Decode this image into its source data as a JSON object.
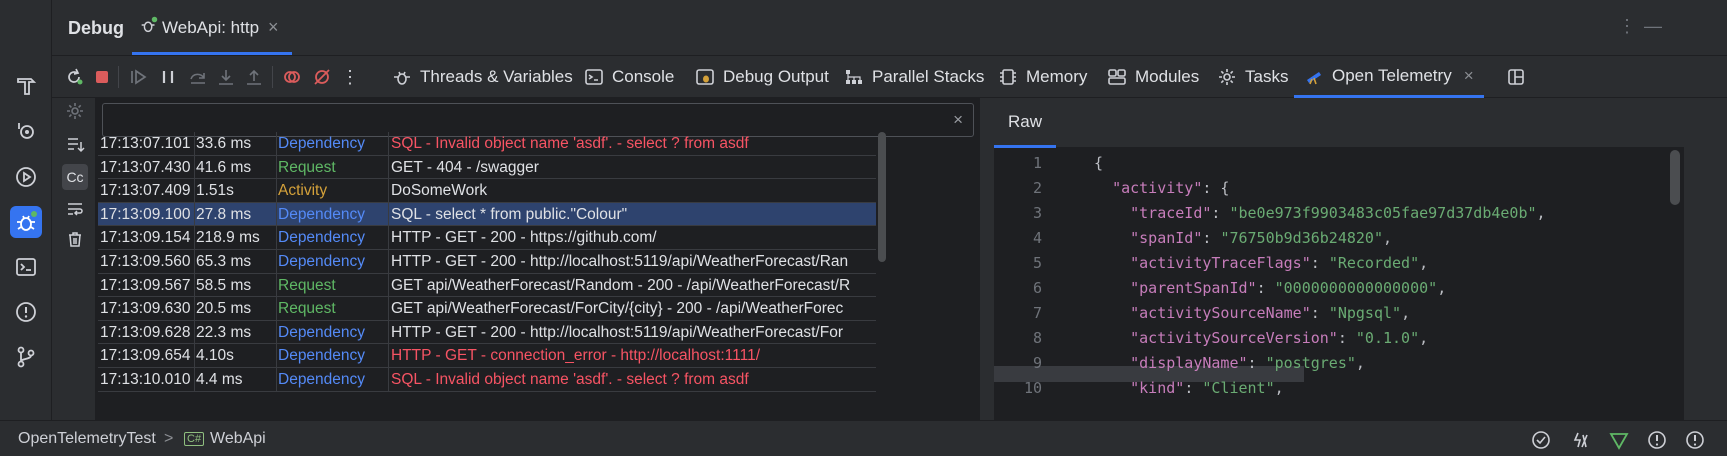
{
  "header": {
    "title": "Debug",
    "tab_label": "WebApi: http",
    "tab_close": "×",
    "more": "⋮",
    "minimize": "—"
  },
  "toolbar": {
    "tabs": [
      {
        "label": "Threads & Variables"
      },
      {
        "label": "Console"
      },
      {
        "label": "Debug Output"
      },
      {
        "label": "Parallel Stacks"
      },
      {
        "label": "Memory"
      },
      {
        "label": "Modules"
      },
      {
        "label": "Tasks"
      },
      {
        "label": "Open Telemetry",
        "close": "×"
      }
    ]
  },
  "search": {
    "value": "",
    "placeholder": "",
    "clear": "×"
  },
  "logs": [
    {
      "time": "17:13:07.101",
      "duration": "33.6 ms",
      "kind": "Dependency",
      "message": "SQL - Invalid object name 'asdf'. - select ? from asdf",
      "kind_color": "#548af7",
      "msg_color": "#f75464"
    },
    {
      "time": "17:13:07.430",
      "duration": "41.6 ms",
      "kind": "Request",
      "message": "GET - 404 - /swagger",
      "kind_color": "#5fb865",
      "msg_color": "#dfe1e5"
    },
    {
      "time": "17:13:07.409",
      "duration": "1.51s",
      "kind": "Activity",
      "message": "DoSomeWork",
      "kind_color": "#d4a13a",
      "msg_color": "#dfe1e5"
    },
    {
      "time": "17:13:09.100",
      "duration": "27.8 ms",
      "kind": "Dependency",
      "message": "SQL - select * from public.\"Colour\"",
      "kind_color": "#548af7",
      "msg_color": "#dfe1e5"
    },
    {
      "time": "17:13:09.154",
      "duration": "218.9 ms",
      "kind": "Dependency",
      "message": "HTTP - GET - 200 - https://github.com/",
      "kind_color": "#548af7",
      "msg_color": "#dfe1e5"
    },
    {
      "time": "17:13:09.560",
      "duration": "65.3 ms",
      "kind": "Dependency",
      "message": "HTTP - GET - 200 - http://localhost:5119/api/WeatherForecast/Ran",
      "kind_color": "#548af7",
      "msg_color": "#dfe1e5"
    },
    {
      "time": "17:13:09.567",
      "duration": "58.5 ms",
      "kind": "Request",
      "message": "GET api/WeatherForecast/Random - 200 - /api/WeatherForecast/R",
      "kind_color": "#5fb865",
      "msg_color": "#dfe1e5"
    },
    {
      "time": "17:13:09.630",
      "duration": "20.5 ms",
      "kind": "Request",
      "message": "GET api/WeatherForecast/ForCity/{city} - 200 - /api/WeatherForec",
      "kind_color": "#5fb865",
      "msg_color": "#dfe1e5"
    },
    {
      "time": "17:13:09.628",
      "duration": "22.3 ms",
      "kind": "Dependency",
      "message": "HTTP - GET - 200 - http://localhost:5119/api/WeatherForecast/For",
      "kind_color": "#548af7",
      "msg_color": "#dfe1e5"
    },
    {
      "time": "17:13:09.654",
      "duration": "4.10s",
      "kind": "Dependency",
      "message": "HTTP - GET - connection_error - http://localhost:1111/",
      "kind_color": "#548af7",
      "msg_color": "#f75464"
    },
    {
      "time": "17:13:10.010",
      "duration": "4.4 ms",
      "kind": "Dependency",
      "message": "SQL - Invalid object name 'asdf'. - select ? from asdf",
      "kind_color": "#548af7",
      "msg_color": "#f75464"
    }
  ],
  "raw": {
    "tab_label": "Raw",
    "line_numbers": [
      "1",
      "2",
      "3",
      "4",
      "5",
      "6",
      "7",
      "8",
      "9",
      "10"
    ],
    "lines": [
      "{",
      "  \"activity\": {",
      "    \"traceId\": \"be0e973f9903483c05fae97d37db4e0b\",",
      "    \"spanId\": \"76750b9d36b24820\",",
      "    \"activityTraceFlags\": \"Recorded\",",
      "    \"parentSpanId\": \"0000000000000000\",",
      "    \"activitySourceName\": \"Npgsql\",",
      "    \"activitySourceVersion\": \"0.1.0\",",
      "    \"displayName\": \"postgres\",",
      "    \"kind\": \"Client\","
    ]
  },
  "status": {
    "project": "OpenTelemetryTest",
    "separator": ">",
    "csharp_badge": "C#",
    "module": "WebApi"
  },
  "colors": {
    "accent": "#3574f0",
    "selected_row": "#2e436e"
  }
}
